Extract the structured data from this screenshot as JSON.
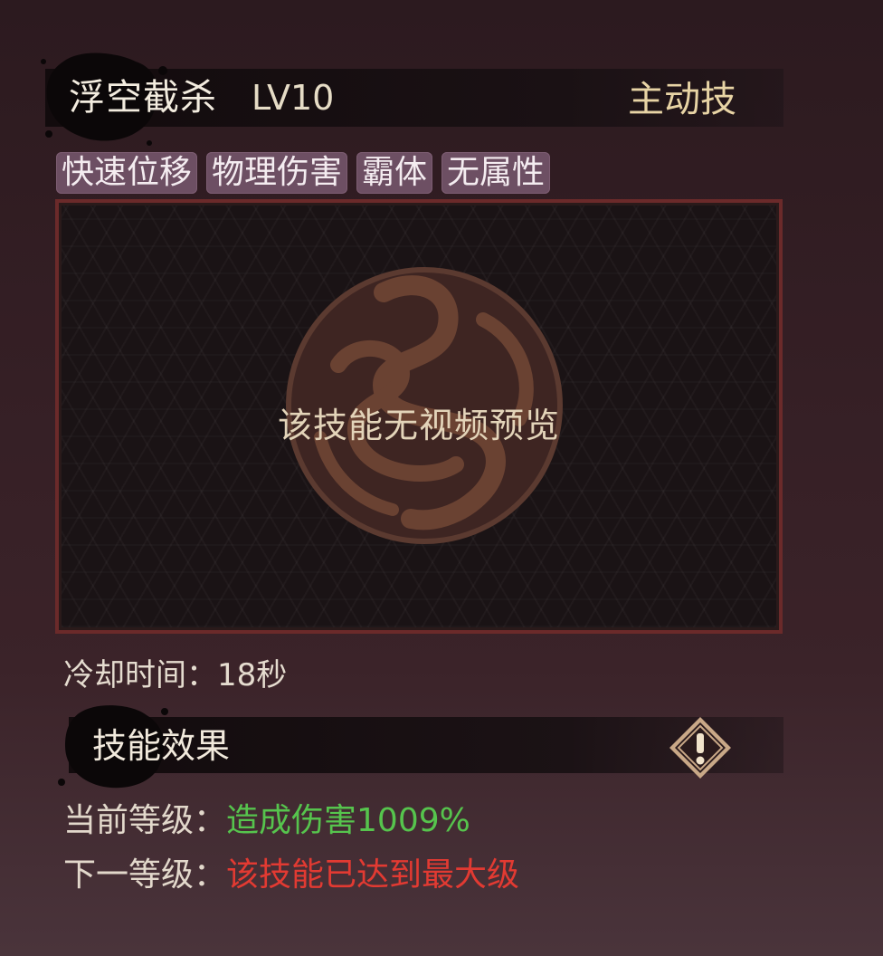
{
  "skill": {
    "name": "浮空截杀",
    "level": "LV10",
    "type": "主动技"
  },
  "tags": [
    "快速位移",
    "物理伤害",
    "霸体",
    "无属性"
  ],
  "preview": {
    "message": "该技能无视频预览"
  },
  "cooldown": {
    "label": "冷却时间：",
    "value": "18秒"
  },
  "effects": {
    "title": "技能效果",
    "info_icon": "exclamation-diamond-icon",
    "current_label": "当前等级：",
    "current_value": "造成伤害1009%",
    "next_label": "下一等级：",
    "next_value": "该技能已达到最大级"
  },
  "colors": {
    "title_type": "#e8d4a5",
    "tag_bg": "#6d4f63",
    "preview_border": "#6b2a2a",
    "current_value": "#56c44d",
    "next_value": "#e23a32"
  }
}
